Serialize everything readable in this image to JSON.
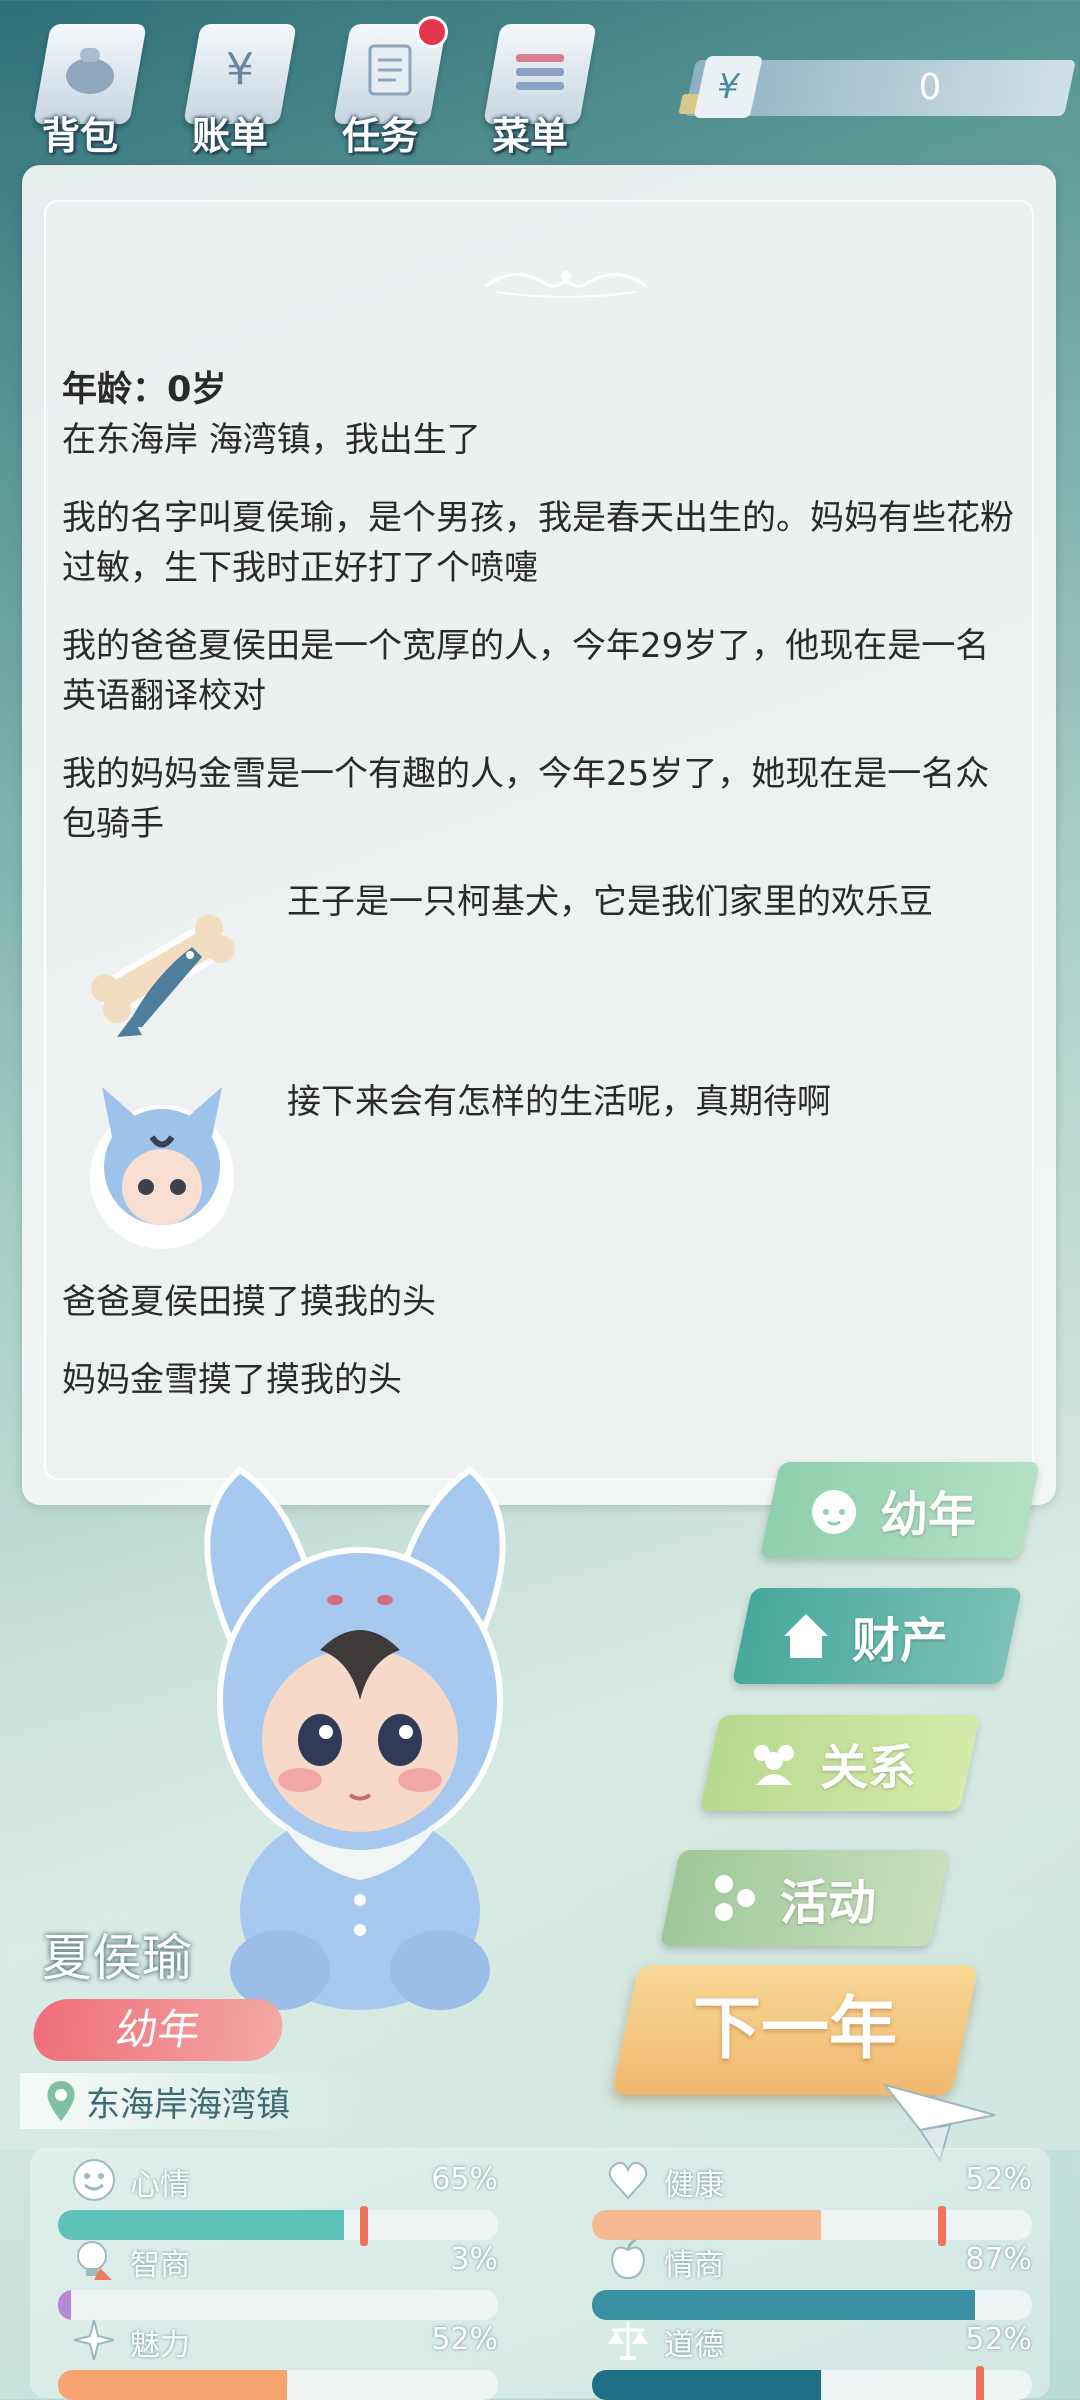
{
  "topbar": {
    "buttons": [
      {
        "label": "背包",
        "icon": "bag-icon"
      },
      {
        "label": "账单",
        "icon": "bill-icon"
      },
      {
        "label": "任务",
        "icon": "task-icon",
        "has_badge": true
      },
      {
        "label": "菜单",
        "icon": "menu-icon"
      }
    ],
    "money": {
      "symbol": "¥",
      "amount": "0"
    }
  },
  "story": {
    "age_line": "年龄：0岁",
    "paragraphs": [
      "在东海岸 海湾镇，我出生了",
      "我的名字叫夏侯瑜，是个男孩，我是春天出生的。妈妈有些花粉过敏，生下我时正好打了个喷嚏",
      "我的爸爸夏侯田是一个宽厚的人，今年29岁了，他现在是一名英语翻译校对",
      "我的妈妈金雪是一个有趣的人，今年25岁了，她现在是一名众包骑手"
    ],
    "pet_line": "王子是一只柯基犬，它是我们家里的欢乐豆",
    "future_line": "接下来会有怎样的生活呢，真期待啊",
    "events": [
      "爸爸夏侯田摸了摸我的头",
      "妈妈金雪摸了摸我的头"
    ]
  },
  "tabs": {
    "childhood": "幼年",
    "assets": "财产",
    "relations": "关系",
    "activities": "活动"
  },
  "next_year": "下一年",
  "character": {
    "name": "夏侯瑜",
    "stage": "幼年",
    "location": "东海岸海湾镇"
  },
  "stats": {
    "mood": {
      "name": "心情",
      "value": "65%",
      "fill": 0.65,
      "color": "#5fc2b9"
    },
    "health": {
      "name": "健康",
      "value": "52%",
      "fill": 0.52,
      "color": "#f6b890"
    },
    "iq": {
      "name": "智商",
      "value": "3%",
      "fill": 0.03,
      "color": "#b888d6"
    },
    "eq": {
      "name": "情商",
      "value": "87%",
      "fill": 0.87,
      "color": "#3a8fa0"
    },
    "charm": {
      "name": "魅力",
      "value": "52%",
      "fill": 0.52,
      "color": "#f7a471"
    },
    "moral": {
      "name": "道德",
      "value": "52%",
      "fill": 0.52,
      "color": "#1f6f85"
    }
  }
}
